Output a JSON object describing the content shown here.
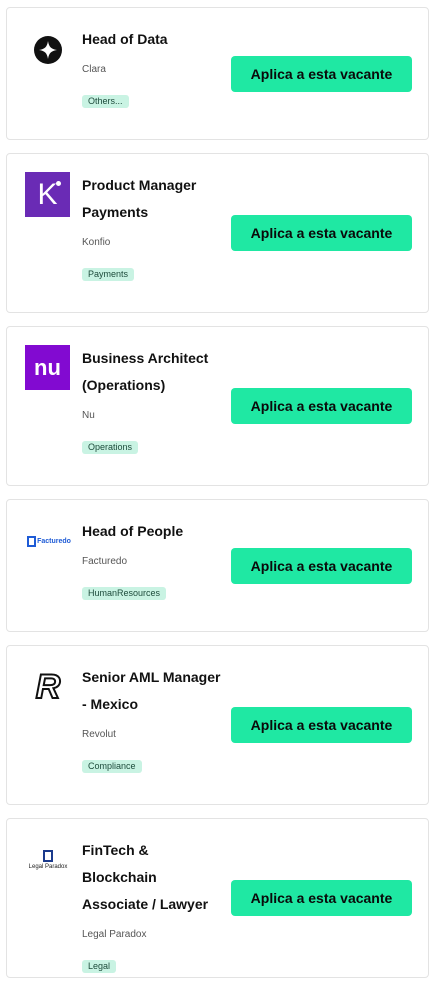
{
  "jobs": [
    {
      "title": "Head of Data",
      "company": "Clara",
      "tag": "Others...",
      "button": "Aplica a esta vacante",
      "logo": "clara-star-logo"
    },
    {
      "title": "Product Manager Payments",
      "company": "Konfio",
      "tag": "Payments",
      "button": "Aplica a esta vacante",
      "logo": "konfio-k-logo",
      "logo_text": "K"
    },
    {
      "title": "Business Architect (Operations)",
      "company": "Nu",
      "tag": "Operations",
      "button": "Aplica a esta vacante",
      "logo": "nu-logo",
      "logo_text": "nu"
    },
    {
      "title": "Head of People",
      "company": "Facturedo",
      "tag": "HumanResources",
      "button": "Aplica a esta vacante",
      "logo": "facturedo-logo",
      "logo_text": "Facturedo"
    },
    {
      "title": "Senior AML Manager - Mexico",
      "company": "Revolut",
      "tag": "Compliance",
      "button": "Aplica a esta vacante",
      "logo": "revolut-r-logo",
      "logo_text": "R"
    },
    {
      "title": "FinTech & Blockchain Associate / Lawyer",
      "company": "Legal Paradox",
      "tag": "Legal",
      "button": "Aplica a esta vacante",
      "logo": "legal-paradox-logo",
      "logo_text": "Legal Paradox"
    }
  ],
  "colors": {
    "button": "#1fe8a3",
    "tag_bg": "#c9f3e3",
    "konfio": "#6a2bb5",
    "nu": "#820ad1",
    "facturedo": "#1e5bd6"
  }
}
